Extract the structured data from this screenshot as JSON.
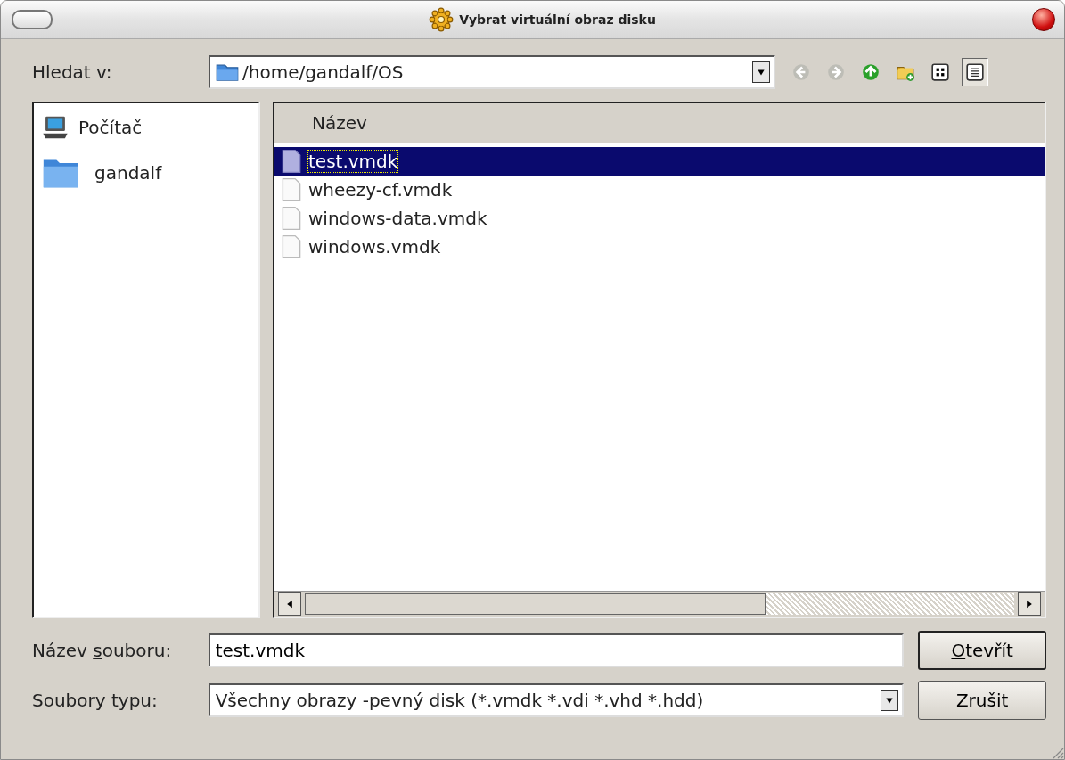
{
  "window": {
    "title": "Vybrat virtuální obraz disku"
  },
  "location": {
    "label": "Hledat v:",
    "path": "/home/gandalf/OS"
  },
  "toolbar": [
    {
      "kind": "back",
      "disabled": true
    },
    {
      "kind": "forward",
      "disabled": true
    },
    {
      "kind": "up"
    },
    {
      "kind": "new-folder"
    },
    {
      "kind": "icon-view",
      "selected": false
    },
    {
      "kind": "list-view",
      "selected": true
    }
  ],
  "sidebar": {
    "items": [
      {
        "kind": "computer",
        "label": "Počítač"
      },
      {
        "kind": "folder",
        "label": "gandalf"
      }
    ]
  },
  "file_list": {
    "columns": [
      "Název"
    ],
    "rows": [
      {
        "name": "test.vmdk",
        "selected": true
      },
      {
        "name": "wheezy-cf.vmdk",
        "selected": false
      },
      {
        "name": "windows-data.vmdk",
        "selected": false
      },
      {
        "name": "windows.vmdk",
        "selected": false
      }
    ]
  },
  "filename": {
    "label": {
      "before": "Název ",
      "key": "s",
      "after": "ouboru:"
    },
    "value": "test.vmdk"
  },
  "filetype": {
    "label": "Soubory typu:",
    "value": "Všechny obrazy -pevný disk (*.vmdk *.vdi *.vhd *.hdd)"
  },
  "buttons": [
    {
      "label": {
        "key": "O",
        "after": "tevřít"
      },
      "default": true
    },
    {
      "label": {
        "before": "Zrušit"
      },
      "default": false
    }
  ]
}
